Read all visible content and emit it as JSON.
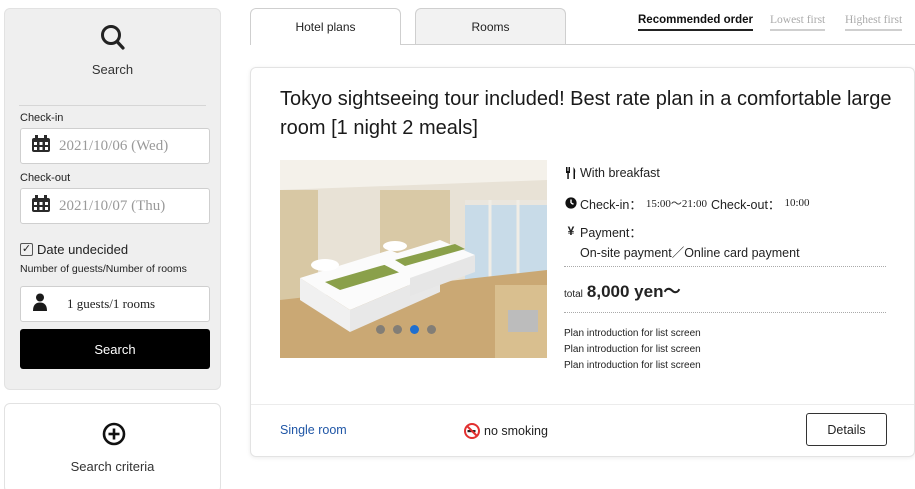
{
  "sidebar": {
    "search_label": "Search",
    "checkin_label": "Check-in",
    "checkin_value": "2021/10/06 (Wed)",
    "checkout_label": "Check-out",
    "checkout_value": "2021/10/07 (Thu)",
    "date_undecided_label": "Date undecided",
    "date_undecided_checked": true,
    "guests_label": "Number of guests/Number of rooms",
    "guests_value": "1 guests/1 rooms",
    "search_button": "Search",
    "criteria_label": "Search criteria"
  },
  "tabs": [
    {
      "label": "Hotel plans",
      "active": true
    },
    {
      "label": "Rooms",
      "active": false
    }
  ],
  "sort": [
    {
      "label": "Recommended order",
      "active": true
    },
    {
      "label": "Lowest first",
      "active": false
    },
    {
      "label": "Highest first",
      "active": false
    }
  ],
  "plan": {
    "title": "Tokyo sightseeing tour included! Best rate plan in a comfortable large room [1 night 2 meals]",
    "meal": "With breakfast",
    "checkin_label": "Check-in：",
    "checkin_time": "15:00～21:00",
    "checkout_label": "Check-out：",
    "checkout_time": "10:00",
    "payment_label": "Payment：",
    "payment_methods": "On-site payment／Online card payment",
    "total_label": "total",
    "price": "8,000 yen～",
    "intro_lines": [
      "Plan introduction for list screen",
      "Plan introduction for list screen",
      "Plan introduction for list screen"
    ],
    "room_type": "Single room",
    "smoking": "no smoking",
    "details_button": "Details",
    "carousel": {
      "count": 4,
      "active_index": 2
    }
  },
  "colors": {
    "link_blue": "#1f56a6",
    "carousel_active": "#1f6fd0",
    "sidebar_bg": "#efefef",
    "button_black": "#000000"
  },
  "icons": {
    "search": "search-icon",
    "calendar": "calendar-icon",
    "person": "person-icon",
    "add_circle": "plus-circle-icon",
    "meal": "fork-knife-icon",
    "clock": "clock-icon",
    "yen": "yen-icon",
    "no_smoking": "no-smoking-icon"
  }
}
